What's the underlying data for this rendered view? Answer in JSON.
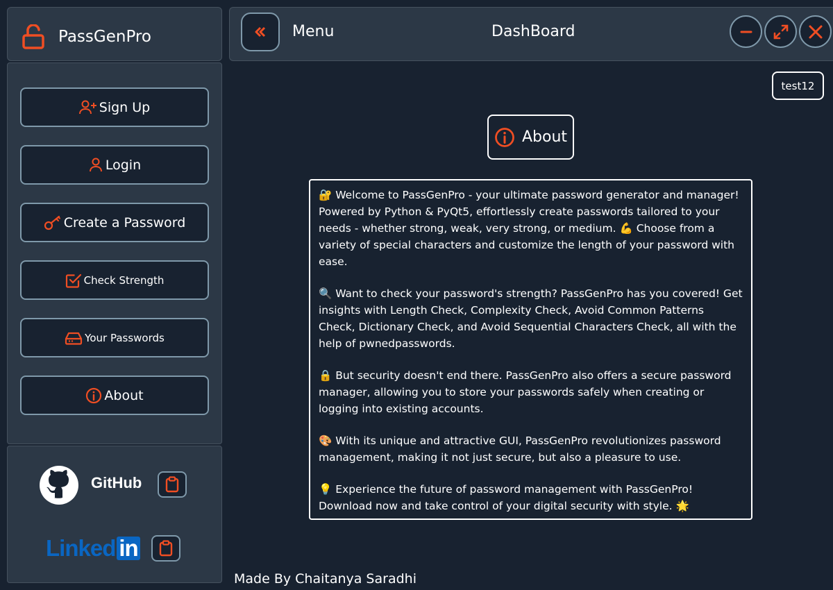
{
  "app": {
    "title": "PassGenPro"
  },
  "colors": {
    "accent": "#f04e23",
    "background": "#182230",
    "panel": "#2c3846",
    "border": "#7f99aa"
  },
  "topbar": {
    "menu_label": "Menu",
    "page_title": "DashBoard",
    "icons": {
      "collapse": "double-chevron-left-icon",
      "minimize": "minus-icon",
      "maximize": "expand-icon",
      "close": "close-icon"
    }
  },
  "sidebar": {
    "items": [
      {
        "label": "Sign Up",
        "icon": "user-plus-icon"
      },
      {
        "label": "Login",
        "icon": "user-icon"
      },
      {
        "label": "Create a Password",
        "icon": "key-icon"
      },
      {
        "label": "Check Strength",
        "icon": "check-square-icon"
      },
      {
        "label": "Your Passwords",
        "icon": "hard-drive-icon"
      },
      {
        "label": "About",
        "icon": "info-icon"
      }
    ]
  },
  "social": {
    "github_label": "GitHub",
    "linkedin_label": "Linked",
    "linkedin_badge": "in"
  },
  "user": {
    "name": "test12"
  },
  "about": {
    "heading": "About",
    "paragraphs": [
      "🔐 Welcome to PassGenPro - your ultimate password generator and manager! Powered by Python & PyQt5, effortlessly create passwords tailored to your needs - whether strong, weak, very strong, or medium. 💪 Choose from a variety of special characters and customize the length of your password with ease.",
      "🔍 Want to check your password's strength? PassGenPro has you covered! Get insights with Length Check, Complexity Check, Avoid Common Patterns Check, Dictionary Check, and Avoid Sequential Characters Check, all with the help of pwnedpasswords.",
      "🔒 But security doesn't end there. PassGenPro also offers a secure password manager, allowing you to store your passwords safely when creating or logging into existing accounts.",
      "🎨 With its unique and attractive GUI, PassGenPro revolutionizes password management, making it not just secure, but also a pleasure to use.",
      "💡 Experience the future of password management with PassGenPro! Download now and take control of your digital security with style. 🌟"
    ]
  },
  "footer": {
    "credit": "Made By Chaitanya Saradhi"
  }
}
